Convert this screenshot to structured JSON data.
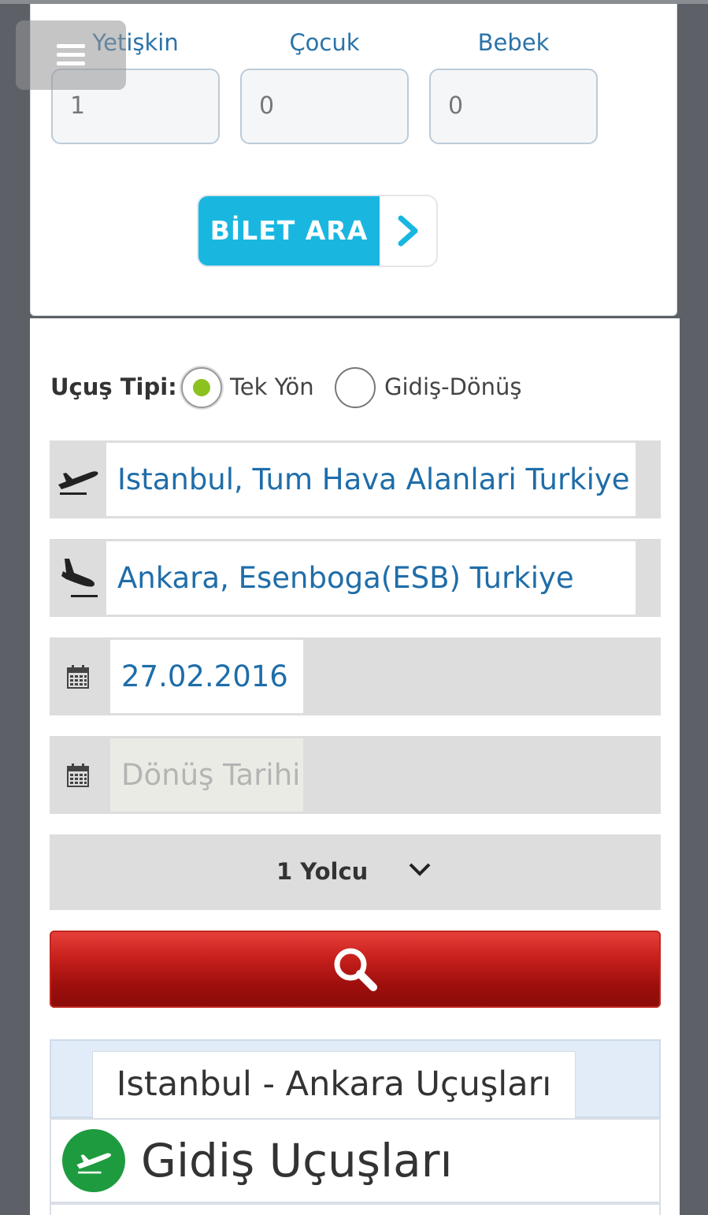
{
  "passengers": {
    "adult_label": "Yetişkin",
    "child_label": "Çocuk",
    "infant_label": "Bebek",
    "adult_value": "1",
    "child_value": "0",
    "infant_value": "0"
  },
  "bilet_ara_label": "BİLET ARA",
  "flight_type": {
    "label": "Uçuş Tipi:",
    "options": [
      "Tek Yön",
      "Gidiş-Dönüş"
    ],
    "selected": "Tek Yön"
  },
  "from_value": "Istanbul, Tum Hava Alanlari Turkiye",
  "to_value": "Ankara, Esenboga(ESB) Turkiye",
  "depart_date": "27.02.2016",
  "return_date_placeholder": "Dönüş Tarihi",
  "passenger_summary": "1 Yolcu",
  "results_title": "Istanbul - Ankara Uçuşları",
  "outbound_title": "Gidiş Uçuşları",
  "colors": {
    "accent_blue": "#19b7e0",
    "search_red": "#c8201c",
    "radio_green": "#8cc21f",
    "link_blue": "#1f6da9",
    "outbound_green": "#1e9b3f"
  },
  "icons": [
    "menu-icon",
    "chevron-right-icon",
    "takeoff-icon",
    "landing-icon",
    "calendar-icon",
    "chevron-down-icon",
    "search-icon",
    "plane-icon"
  ]
}
